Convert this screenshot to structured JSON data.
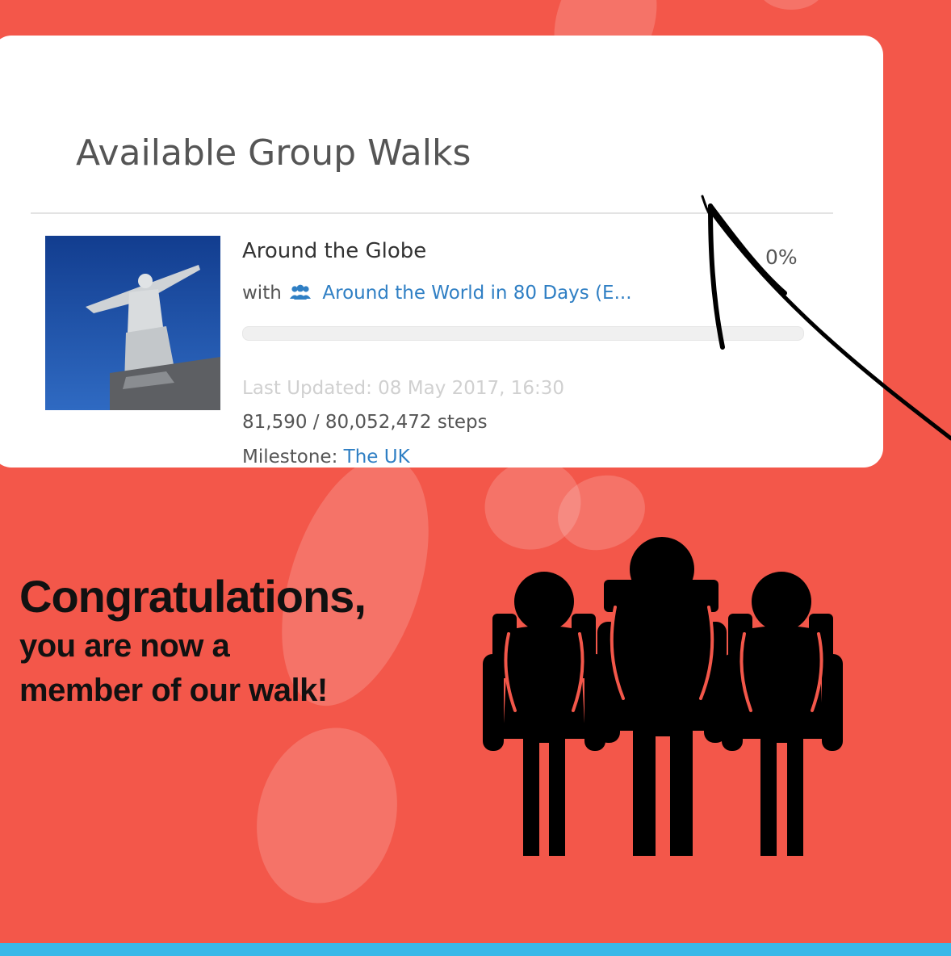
{
  "card": {
    "title": "Available Group Walks",
    "walk": {
      "name": "Around the Globe",
      "progress_percent_label": "0%",
      "progress_fraction": 0,
      "with_prefix": "with",
      "group_icon": "users-icon",
      "group_name": "Around the World in 80 Days (E...",
      "last_updated": "Last Updated: 08 May 2017, 16:30",
      "steps": "81,590 / 80,052,472 steps",
      "milestone_prefix": "Milestone:",
      "milestone_name": "The UK"
    }
  },
  "message": {
    "headline": "Congratulations,",
    "line1": "you are now a",
    "line2": "member of our walk!"
  },
  "colors": {
    "background": "#f3574a",
    "link": "#2f7fc4",
    "strip": "#3ab8e8"
  }
}
